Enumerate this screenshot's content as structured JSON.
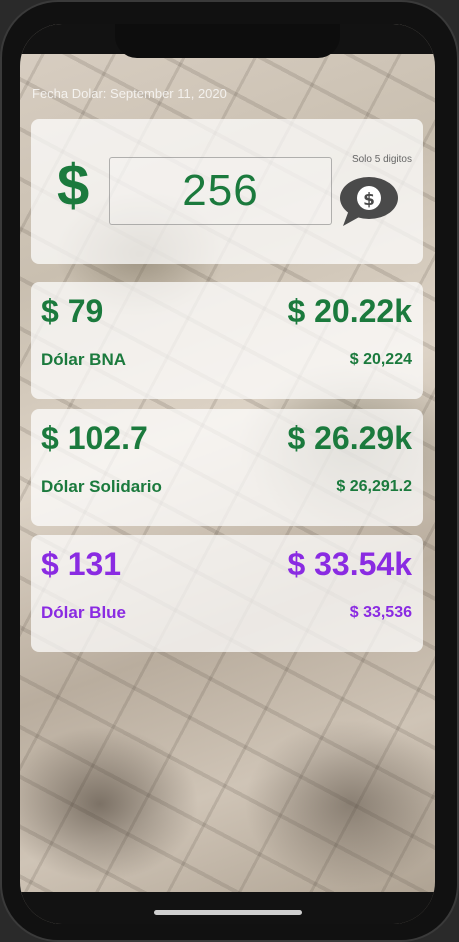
{
  "header": {
    "date_text": "Fecha Dolar: September 11, 2020"
  },
  "converter": {
    "currency_symbol": "$",
    "amount_value": "256",
    "hint_text": "Solo 5 digitos",
    "convert_button_icon": "dollar-speech-bubble-icon"
  },
  "rates": [
    {
      "rate": "$ 79",
      "total_short": "$ 20.22k",
      "name": "Dólar BNA",
      "total_full": "$ 20,224"
    },
    {
      "rate": "$ 102.7",
      "total_short": "$ 26.29k",
      "name": "Dólar Solidario",
      "total_full": "$ 26,291.2"
    },
    {
      "rate": "$ 131",
      "total_short": "$ 33.54k",
      "name": "Dólar Blue",
      "total_full": "$ 33,536"
    }
  ],
  "colors": {
    "green": "#1b7a3d",
    "purple": "#8a2be2",
    "card_bg": "#ffffffb8"
  }
}
